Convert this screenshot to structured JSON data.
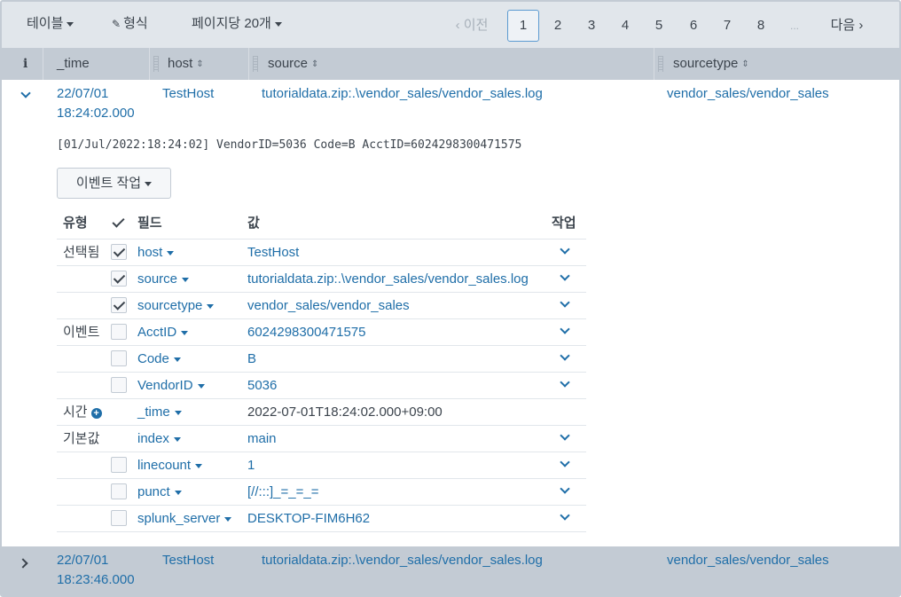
{
  "toolbar": {
    "table_label": "테이블",
    "format_label": "형식",
    "per_page_label": "페이지당 20개",
    "prev_label": "‹ 이전",
    "next_label": "다음 ›",
    "pages": [
      "1",
      "2",
      "3",
      "4",
      "5",
      "6",
      "7",
      "8",
      "..."
    ],
    "active_page": "1"
  },
  "columns": {
    "info": "i",
    "time": "_time",
    "host": "host",
    "source": "source",
    "sourcetype": "sourcetype"
  },
  "events": [
    {
      "time_line1": "22/07/01",
      "time_line2": "18:24:02.000",
      "host": "TestHost",
      "source": "tutorialdata.zip:.\\vendor_sales/vendor_sales.log",
      "sourcetype": "vendor_sales/vendor_sales",
      "raw": "[01/Jul/2022:18:24:02] VendorID=5036 Code=B AcctID=6024298300471575",
      "event_action_label": "이벤트 작업"
    },
    {
      "time_line1": "22/07/01",
      "time_line2": "18:23:46.000",
      "host": "TestHost",
      "source": "tutorialdata.zip:.\\vendor_sales/vendor_sales.log",
      "sourcetype": "vendor_sales/vendor_sales"
    }
  ],
  "fields_table": {
    "headers": {
      "type": "유형",
      "field": "필드",
      "value": "값",
      "action": "작업"
    },
    "groups": {
      "selected": "선택됨",
      "event": "이벤트",
      "time": "시간",
      "default": "기본값"
    },
    "rows": [
      {
        "field": "host",
        "value": "TestHost",
        "checked": true
      },
      {
        "field": "source",
        "value": "tutorialdata.zip:.\\vendor_sales/vendor_sales.log",
        "checked": true
      },
      {
        "field": "sourcetype",
        "value": "vendor_sales/vendor_sales",
        "checked": true
      },
      {
        "field": "AcctID",
        "value": "6024298300471575",
        "checked": false
      },
      {
        "field": "Code",
        "value": "B",
        "checked": false
      },
      {
        "field": "VendorID",
        "value": "5036",
        "checked": false
      },
      {
        "field": "_time",
        "value": "2022-07-01T18:24:02.000+09:00",
        "checked": false
      },
      {
        "field": "index",
        "value": "main",
        "checked": false
      },
      {
        "field": "linecount",
        "value": "1",
        "checked": false
      },
      {
        "field": "punct",
        "value": "[//:::]_=_=_=",
        "checked": false
      },
      {
        "field": "splunk_server",
        "value": "DESKTOP-FIM6H62",
        "checked": false
      }
    ]
  }
}
